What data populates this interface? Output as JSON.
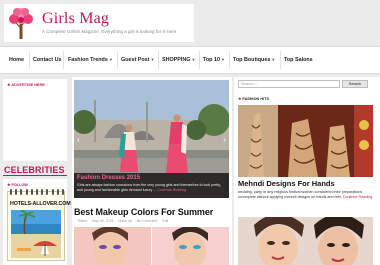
{
  "site": {
    "title": "Girls Mag",
    "tagline": "A Complete Girlish Magzine, Everything a girl is looking for is here"
  },
  "nav": {
    "items": [
      {
        "label": "Home",
        "caret": false
      },
      {
        "label": "Contact Us",
        "caret": false
      },
      {
        "label": "Fashion Trends",
        "caret": true
      },
      {
        "label": "Guest Post",
        "caret": true
      },
      {
        "label": "SHOPPING",
        "caret": true
      },
      {
        "label": "Top 10",
        "caret": true
      },
      {
        "label": "Top Boutiques",
        "caret": true
      },
      {
        "label": "Top Salons",
        "caret": false
      }
    ]
  },
  "left_sidebar": {
    "advertise_heading": "ADVERTISE HERE",
    "celebrities_heading": "CELEBRITIES",
    "follow_heading": "FOLLOW",
    "notepad_text": "HOTELS-ALLOVER.COM"
  },
  "featured": {
    "title": "Fashion Dresses 2015",
    "excerpt": "Girls are always fashion conscious from the very young girls and themselves to look pretty, and young and fashionable girls demand luxury ...",
    "more": "Continue Reading"
  },
  "post": {
    "title": "Best Makeup Colors For Summer",
    "meta": [
      "Editor",
      "May 28, 2015",
      "Make up",
      "No Comment",
      "Edit"
    ]
  },
  "right_sidebar": {
    "search_placeholder": "Search ...",
    "search_button": "Search",
    "fashion_heading": "FASHION HITS",
    "article_title": "Mehndi Designs For Hands",
    "article_excerpt": "wedding, party or any religious festival women considered their preparations incomplete without applying mehndi designs on hands and feet,",
    "article_more": "Continue Reading"
  },
  "colors": {
    "brand": "#c2185b",
    "accent_pink": "#f06292",
    "nav_bg": "#ffffff",
    "page_bg": "#ebebeb"
  },
  "icons": {
    "logo": "tree-hearts-icon",
    "caret": "chevron-down-icon",
    "prev": "chevron-left-icon",
    "next": "chevron-right-icon",
    "heading_star": "star-icon"
  }
}
